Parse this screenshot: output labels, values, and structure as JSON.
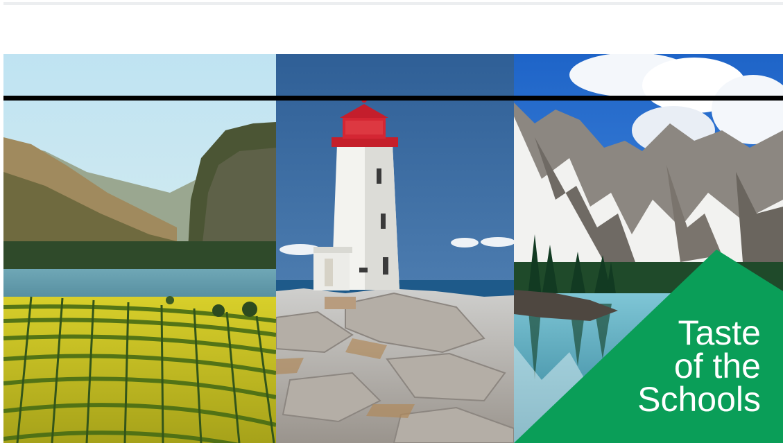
{
  "hero": {
    "panels": [
      {
        "name": "vineyard-lake-photo"
      },
      {
        "name": "lighthouse-photo"
      },
      {
        "name": "mountain-lake-photo"
      }
    ],
    "badge": {
      "lines": [
        "Taste",
        "of the",
        "Schools"
      ],
      "color": "#0a9e58"
    }
  }
}
